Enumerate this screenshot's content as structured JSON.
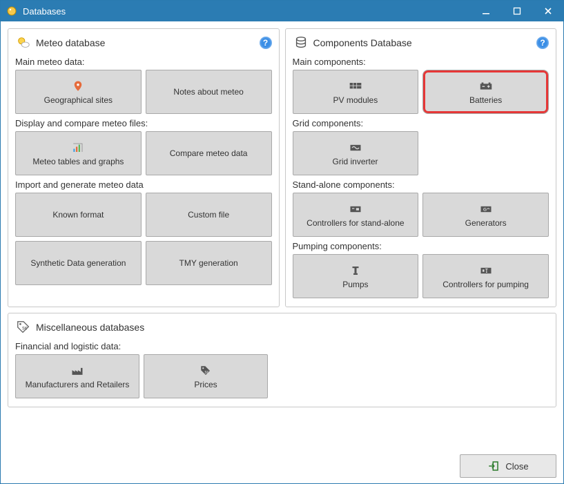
{
  "window": {
    "title": "Databases"
  },
  "meteo": {
    "title": "Meteo database",
    "section_main": "Main meteo data:",
    "geo_sites": "Geographical sites",
    "notes": "Notes about meteo",
    "section_display": "Display and compare meteo files:",
    "tables_graphs": "Meteo tables and graphs",
    "compare": "Compare meteo data",
    "section_import": "Import and generate meteo data",
    "known_format": "Known format",
    "custom_file": "Custom file",
    "synthetic": "Synthetic Data generation",
    "tmy": "TMY generation"
  },
  "components": {
    "title": "Components Database",
    "section_main": "Main components:",
    "pv_modules": "PV modules",
    "batteries": "Batteries",
    "section_grid": "Grid components:",
    "grid_inverter": "Grid inverter",
    "section_standalone": "Stand-alone components:",
    "controllers_sa": "Controllers for stand-alone",
    "generators": "Generators",
    "section_pumping": "Pumping components:",
    "pumps": "Pumps",
    "controllers_pumping": "Controllers for pumping"
  },
  "misc": {
    "title": "Miscellaneous databases",
    "section_fin": "Financial and logistic data:",
    "manufacturers": "Manufacturers and Retailers",
    "prices": "Prices"
  },
  "footer": {
    "close": "Close"
  }
}
